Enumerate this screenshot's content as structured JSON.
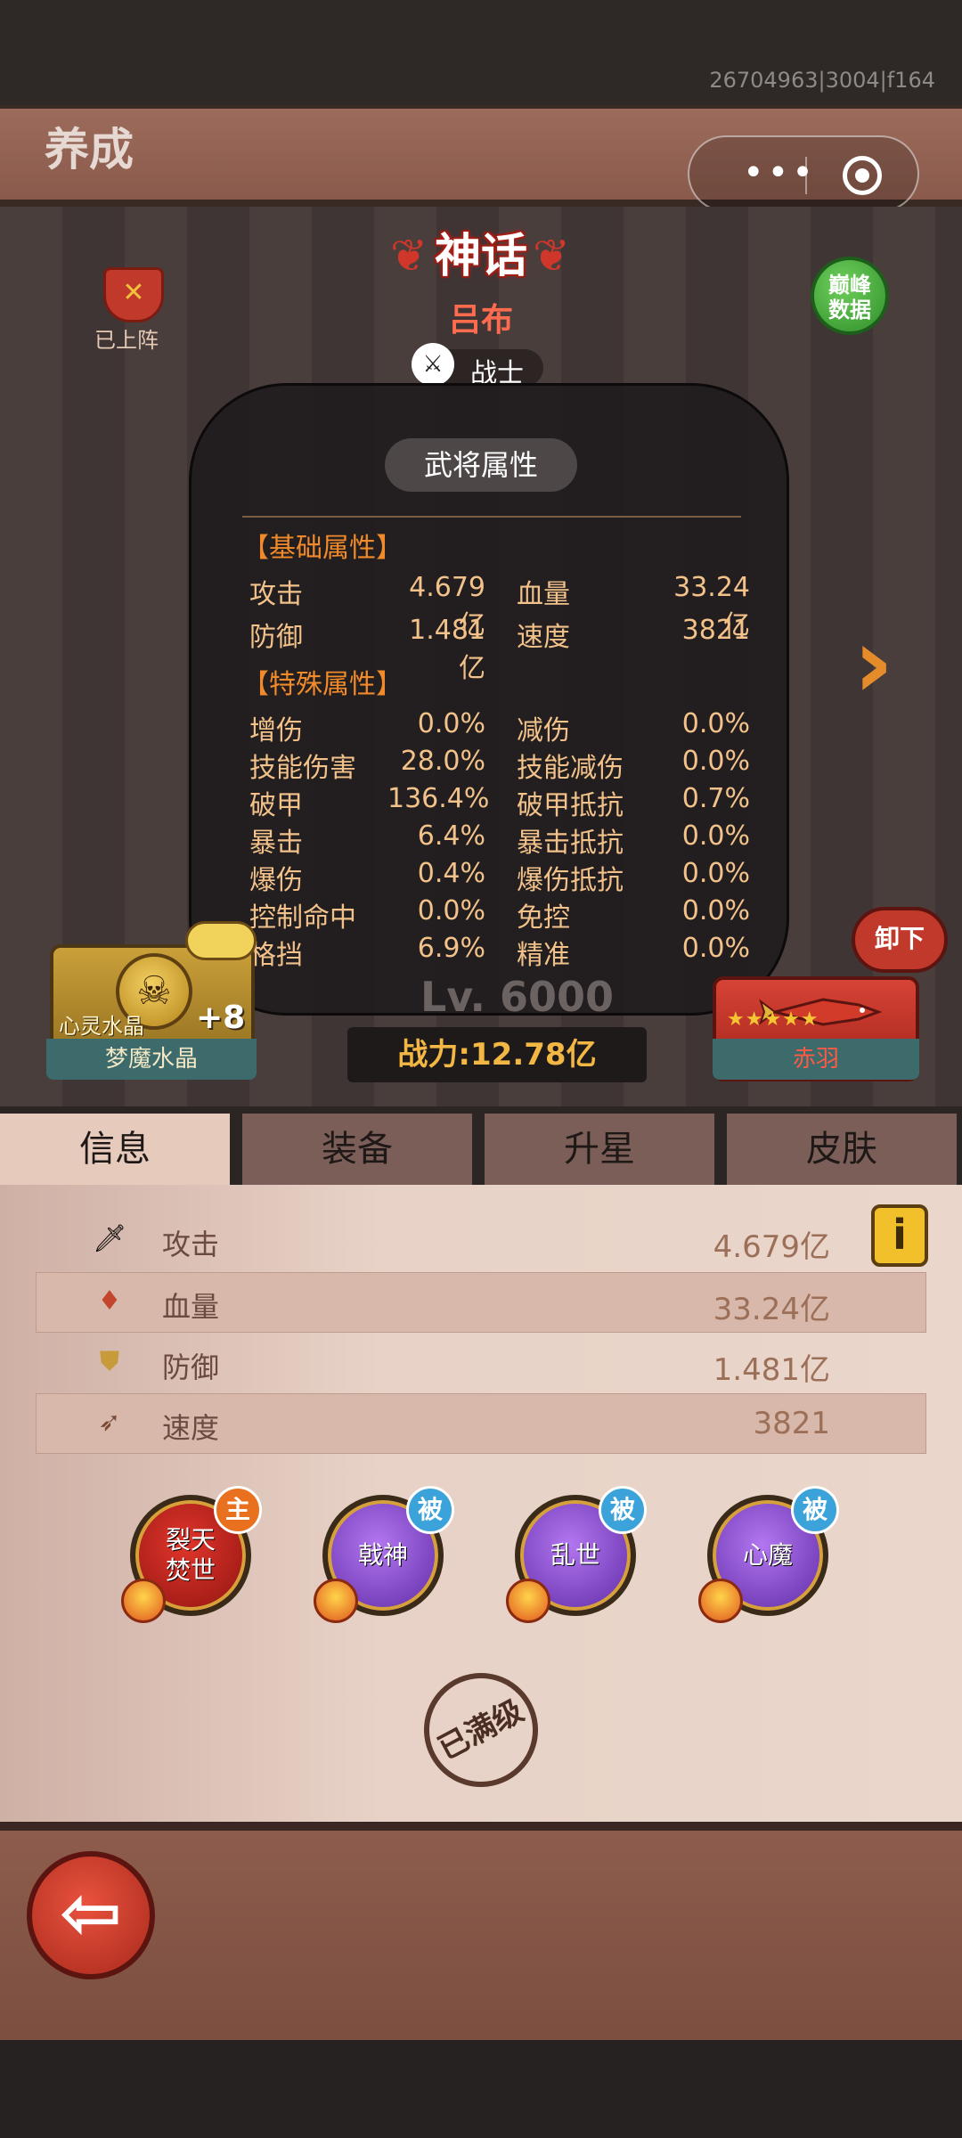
{
  "system": {
    "build_id": "26704963|3004|f164"
  },
  "header": {
    "title": "养成"
  },
  "hero": {
    "on_team_label": "已上阵",
    "rarity": "神话",
    "name": "吕布",
    "class": "战士",
    "peak_data_label": "巅峰数据",
    "level": "Lv. 6000",
    "power": "战力:12.78亿"
  },
  "attributes": {
    "title": "武将属性",
    "basic_title": "【基础属性】",
    "basic": [
      {
        "label": "攻击",
        "value": "4.679亿",
        "label2": "血量",
        "value2": "33.24亿"
      },
      {
        "label": "防御",
        "value": "1.481亿",
        "label2": "速度",
        "value2": "3821"
      }
    ],
    "special_title": "【特殊属性】",
    "special": [
      {
        "label": "增伤",
        "value": "0.0%",
        "label2": "减伤",
        "value2": "0.0%"
      },
      {
        "label": "技能伤害",
        "value": "28.0%",
        "label2": "技能减伤",
        "value2": "0.0%"
      },
      {
        "label": "破甲",
        "value": "136.4%",
        "label2": "破甲抵抗",
        "value2": "0.7%"
      },
      {
        "label": "暴击",
        "value": "6.4%",
        "label2": "暴击抵抗",
        "value2": "0.0%"
      },
      {
        "label": "爆伤",
        "value": "0.4%",
        "label2": "爆伤抵抗",
        "value2": "0.0%"
      },
      {
        "label": "控制命中",
        "value": "0.0%",
        "label2": "免控",
        "value2": "0.0%"
      },
      {
        "label": "格挡",
        "value": "6.9%",
        "label2": "精准",
        "value2": "0.0%"
      }
    ]
  },
  "crystal": {
    "inner_label": "心灵水晶",
    "plus": "+8",
    "name": "梦魔水晶"
  },
  "weapon": {
    "name": "赤羽",
    "stars": "★★★★★",
    "unequip_label": "卸下"
  },
  "tabs": [
    {
      "label": "信息",
      "active": true
    },
    {
      "label": "装备",
      "active": false
    },
    {
      "label": "升星",
      "active": false
    },
    {
      "label": "皮肤",
      "active": false
    }
  ],
  "info_stats": [
    {
      "icon": "sword-icon",
      "label": "攻击",
      "value": "4.679亿"
    },
    {
      "icon": "blood-drop-icon",
      "label": "血量",
      "value": "33.24亿"
    },
    {
      "icon": "shield-icon",
      "label": "防御",
      "value": "1.481亿"
    },
    {
      "icon": "boot-icon",
      "label": "速度",
      "value": "3821"
    }
  ],
  "info_button_label": "i",
  "skills": [
    {
      "name": "裂天焚世",
      "badge": "主"
    },
    {
      "name": "戟神",
      "badge": "被"
    },
    {
      "name": "乱世",
      "badge": "被"
    },
    {
      "name": "心魔",
      "badge": "被"
    }
  ],
  "max_level_stamp": "已满级",
  "colors": {
    "accent_orange": "#f08a2a",
    "attr_text": "#f2c28a",
    "tab_active": "#e6cbbd",
    "tab_inactive": "#7b5e57"
  }
}
